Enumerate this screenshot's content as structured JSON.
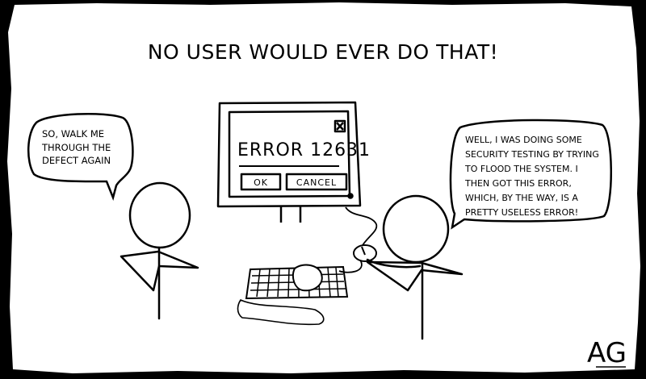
{
  "title": "NO USER WOULD EVER DO THAT!",
  "left_bubble": {
    "lines": [
      "SO, WALK ME",
      "THROUGH THE",
      "DEFECT AGAIN"
    ]
  },
  "right_bubble": {
    "lines": [
      "WELL, I WAS DOING SOME",
      "SECURITY TESTING BY TRYING",
      "TO FLOOD THE SYSTEM. I",
      "THEN GOT THIS ERROR,",
      "WHICH, BY THE WAY, IS  A",
      "PRETTY USELESS ERROR!"
    ]
  },
  "monitor": {
    "error_message": "ERROR 12631",
    "ok_label": "OK",
    "cancel_label": "CANCEL",
    "close_icon": "x-box-icon"
  },
  "signature": "AG"
}
